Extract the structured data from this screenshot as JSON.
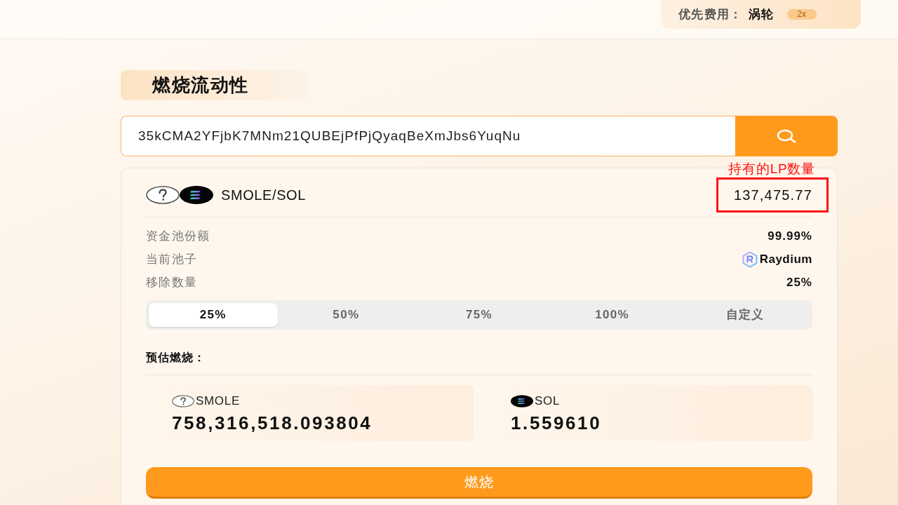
{
  "header": {
    "priority_fee": {
      "label": "优先费用：",
      "value": "涡轮",
      "badge": "2x"
    }
  },
  "title": "燃烧流动性",
  "search": {
    "value": "35kCMA2YFjbK7MNm21QUBEjPfPjQyaqBeXmJbs6YuqNu"
  },
  "pair": {
    "name": "SMOLE/SOL",
    "tokens": [
      {
        "kind": "unknown"
      },
      {
        "kind": "sol"
      }
    ],
    "amount": "137,475.77",
    "annotation": "持有的LP数量"
  },
  "details": [
    {
      "kind": "text",
      "label": "资金池份额",
      "value": "99.99%"
    },
    {
      "kind": "pool",
      "label": "当前池子",
      "value": "Raydium"
    },
    {
      "kind": "text",
      "label": "移除数量",
      "value": "25%"
    }
  ],
  "percent_options": [
    {
      "label": "25%",
      "selected": true
    },
    {
      "label": "50%",
      "selected": false
    },
    {
      "label": "75%",
      "selected": false
    },
    {
      "label": "100%",
      "selected": false
    },
    {
      "label": "自定义",
      "selected": false
    }
  ],
  "estimate": {
    "title": "预估燃烧：",
    "tokens": [
      {
        "kind": "unknown",
        "symbol": "SMOLE",
        "amount": "758,316,518.093804"
      },
      {
        "kind": "sol",
        "symbol": "SOL",
        "amount": "1.559610"
      }
    ]
  },
  "burn_button": "燃烧"
}
